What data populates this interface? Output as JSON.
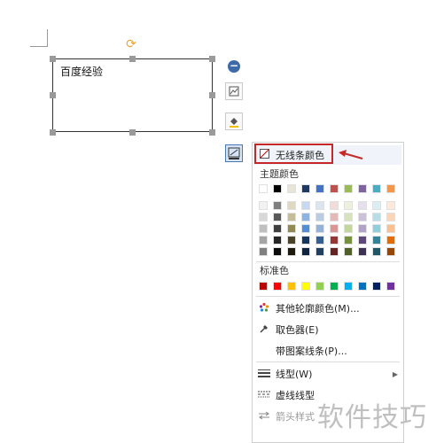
{
  "shape": {
    "text": "百度经验"
  },
  "menu": {
    "no_line_label": "无线条颜色",
    "theme_colors_label": "主题颜色",
    "standard_colors_label": "标准色",
    "theme_top_row": [
      "#ffffff",
      "#000000",
      "#e8e4d8",
      "#1f3864",
      "#4472c4",
      "#c0504d",
      "#9bbb59",
      "#8064a2",
      "#4bacc6",
      "#f79646"
    ],
    "theme_shades": [
      [
        "#f2f2f2",
        "#7f7f7f",
        "#ddd9c3",
        "#c6d9f0",
        "#dbe5f1",
        "#f2dcdb",
        "#ebf1dd",
        "#e5e0ec",
        "#dbeef3",
        "#fdeada"
      ],
      [
        "#d8d8d8",
        "#595959",
        "#c4bd97",
        "#8db3e2",
        "#b8cce4",
        "#e5b9b7",
        "#d7e3bc",
        "#ccc1d9",
        "#b7dde8",
        "#fbd5b5"
      ],
      [
        "#bfbfbf",
        "#3f3f3f",
        "#938953",
        "#548dd4",
        "#95b3d7",
        "#d99694",
        "#c3d69b",
        "#b2a2c7",
        "#92cddc",
        "#fac08f"
      ],
      [
        "#a5a5a5",
        "#262626",
        "#494429",
        "#17365d",
        "#366092",
        "#953734",
        "#76923c",
        "#5f497a",
        "#31859b",
        "#e36c09"
      ],
      [
        "#7f7f7f",
        "#0c0c0c",
        "#1d1b10",
        "#0f243e",
        "#244061",
        "#632423",
        "#4f6128",
        "#3f3151",
        "#205867",
        "#974806"
      ]
    ],
    "standard_row": [
      "#c00000",
      "#ff0000",
      "#ffc000",
      "#ffff00",
      "#92d050",
      "#00b050",
      "#00b0f0",
      "#0070c0",
      "#002060",
      "#7030a0"
    ],
    "items": [
      {
        "label": "其他轮廓颜色(M)...",
        "icon": "color-wheel-icon"
      },
      {
        "label": "取色器(E)",
        "icon": "eyedropper-icon"
      },
      {
        "label": "带图案线条(P)...",
        "icon": ""
      },
      {
        "label": "线型(W)",
        "icon": "line-weight-icon"
      },
      {
        "label": "虚线线型",
        "icon": "dash-line-icon"
      },
      {
        "label": "箭头样式",
        "icon": "arrow-style-icon"
      }
    ]
  },
  "watermark": "软件技巧",
  "accent": "#c62828"
}
